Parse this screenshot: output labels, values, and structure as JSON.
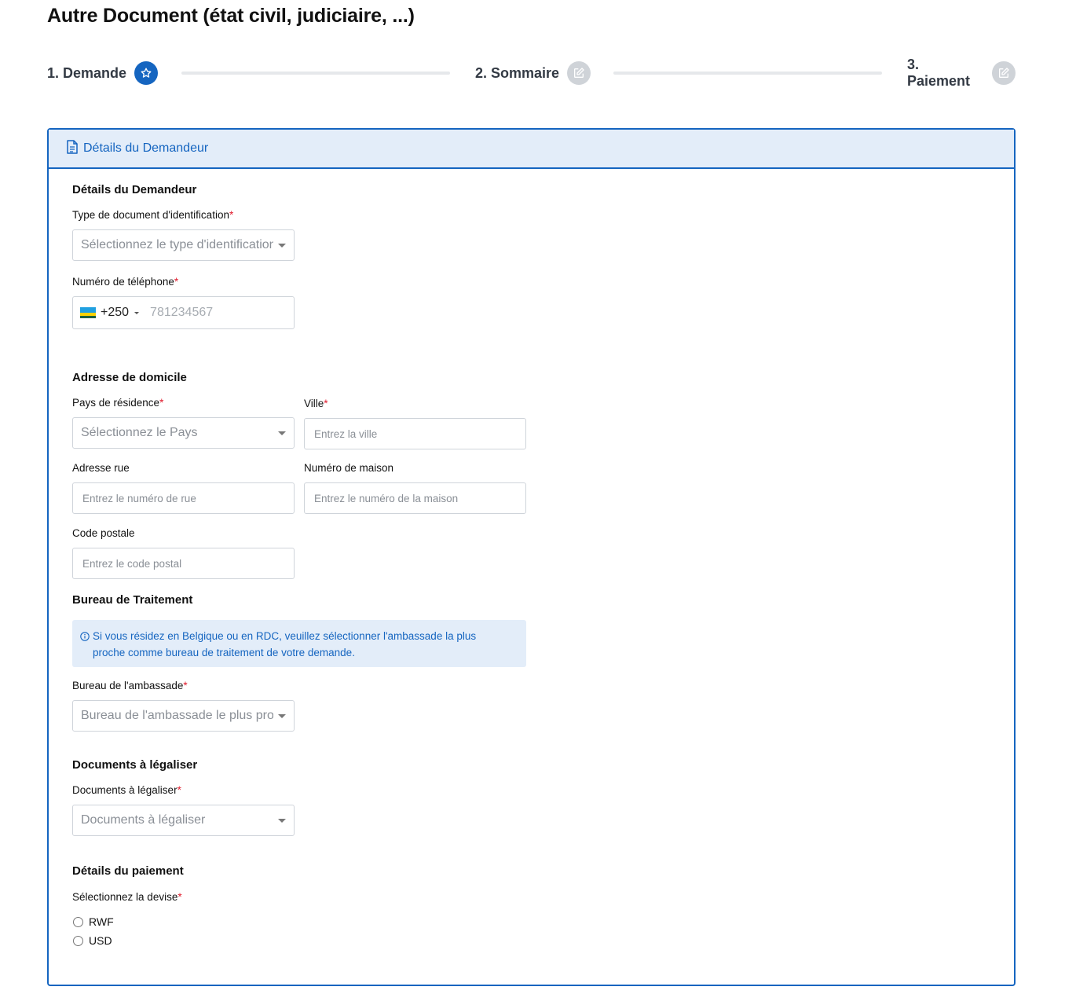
{
  "page": {
    "title": "Autre Document (état civil, judiciaire, ...)"
  },
  "stepper": {
    "steps": [
      {
        "label": "1. Demande",
        "state": "active",
        "icon": "star-icon"
      },
      {
        "label": "2. Sommaire",
        "state": "inactive",
        "icon": "edit-icon"
      },
      {
        "label": "3. Paiement",
        "state": "inactive",
        "icon": "edit-icon"
      }
    ]
  },
  "card": {
    "header_title": "Détails du Demandeur",
    "header_icon": "document-icon"
  },
  "applicant": {
    "section_title": "Détails du Demandeur",
    "id_type": {
      "label": "Type de document d'identification",
      "required_mark": "*",
      "placeholder": "Sélectionnez le type d'identification"
    },
    "phone": {
      "label": "Numéro de téléphone",
      "required_mark": "*",
      "dial_code": "+250",
      "placeholder": "781234567",
      "flag": "rwanda-flag"
    }
  },
  "address": {
    "section_title": "Adresse de domicile",
    "country": {
      "label": "Pays de résidence",
      "required_mark": "*",
      "placeholder": "Sélectionnez le Pays"
    },
    "city": {
      "label": "Ville",
      "required_mark": "*",
      "placeholder": "Entrez la ville"
    },
    "street": {
      "label": "Adresse rue",
      "placeholder": "Entrez le numéro de rue"
    },
    "house": {
      "label": "Numéro de maison",
      "placeholder": "Entrez le numéro de la maison"
    },
    "postal": {
      "label": "Code postale",
      "placeholder": "Entrez le code postal"
    }
  },
  "office": {
    "section_title": "Bureau de Traitement",
    "info_line1": "Si vous résidez en Belgique ou en RDC, veuillez sélectionner l'ambassade la plus",
    "info_line2": "proche comme bureau de traitement de votre demande.",
    "embassy": {
      "label": "Bureau de l'ambassade",
      "required_mark": "*",
      "placeholder": "Bureau de l'ambassade le plus proche"
    }
  },
  "documents": {
    "section_title": "Documents à légaliser",
    "docs": {
      "label": "Documents à légaliser",
      "required_mark": "*",
      "placeholder": "Documents à légaliser"
    }
  },
  "payment": {
    "section_title": "Détails du paiement",
    "currency_label": "Sélectionnez la devise",
    "required_mark": "*",
    "options": [
      "RWF",
      "USD"
    ]
  },
  "colors": {
    "primary": "#1565c0",
    "header_bg": "#e3edf9",
    "required": "#e11d2e",
    "inactive_step": "#cfd3d8"
  }
}
